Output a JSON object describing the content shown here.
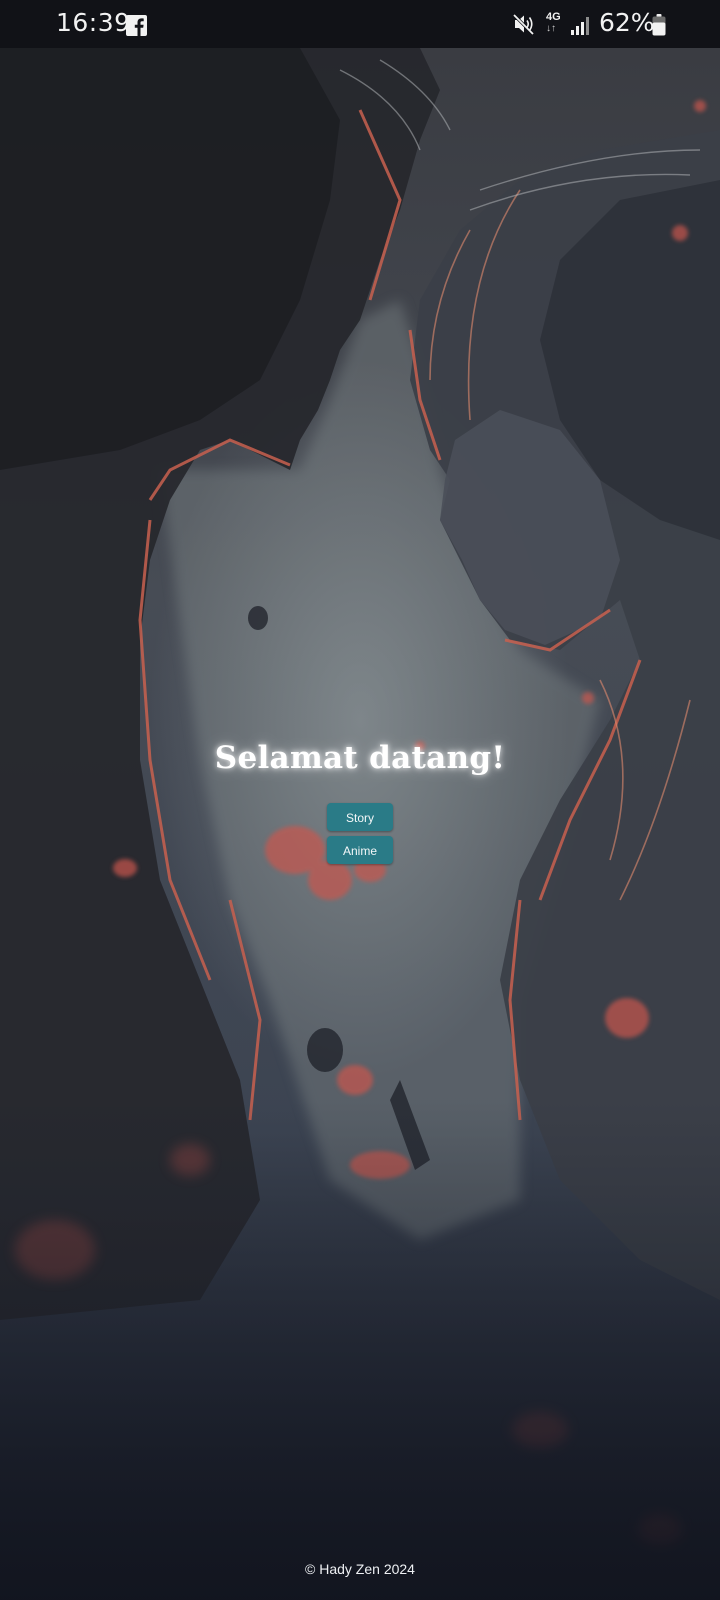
{
  "status_bar": {
    "time": "16:39",
    "network": "4G",
    "network_arrows": "↓↑",
    "battery": "62%",
    "icons": [
      "facebook-icon",
      "mute-icon",
      "signal-icon",
      "battery-icon"
    ]
  },
  "main": {
    "title": "Selamat datang!",
    "buttons": [
      {
        "label": "Story"
      },
      {
        "label": "Anime"
      }
    ]
  },
  "footer": {
    "text": "© Hady Zen 2024"
  },
  "colors": {
    "button_bg": "#2a7b87",
    "status_bar_bg": "#111217",
    "accent_red": "#c9564d"
  }
}
